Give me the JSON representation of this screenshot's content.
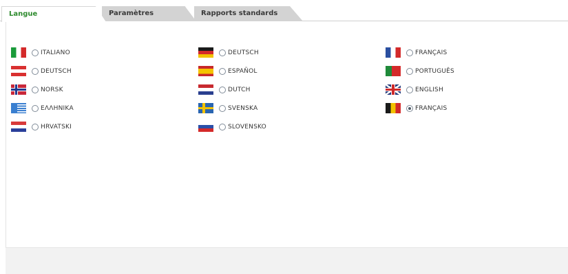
{
  "tabs": [
    {
      "label": "Langue",
      "active": true
    },
    {
      "label": "Paramètres",
      "active": false
    },
    {
      "label": "Rapports standards",
      "active": false
    }
  ],
  "languages": {
    "col1": [
      {
        "label": "ITALIANO",
        "flag": "italy-flag-icon",
        "checked": false
      },
      {
        "label": "DEUTSCH",
        "flag": "austria-flag-icon",
        "checked": false
      },
      {
        "label": "NORSK",
        "flag": "norway-flag-icon",
        "checked": false
      },
      {
        "label": "ΕΛΛΗΝΙΚΑ",
        "flag": "greece-flag-icon",
        "checked": false
      },
      {
        "label": "HRVATSKI",
        "flag": "croatia-flag-icon",
        "checked": false
      }
    ],
    "col2": [
      {
        "label": "DEUTSCH",
        "flag": "germany-flag-icon",
        "checked": false
      },
      {
        "label": "ESPAÑOL",
        "flag": "spain-flag-icon",
        "checked": false
      },
      {
        "label": "DUTCH",
        "flag": "netherlands-flag-icon",
        "checked": false
      },
      {
        "label": "SVENSKA",
        "flag": "sweden-flag-icon",
        "checked": false
      },
      {
        "label": "SLOVENSKO",
        "flag": "slovenia-flag-icon",
        "checked": false
      }
    ],
    "col3": [
      {
        "label": "FRANÇAIS",
        "flag": "france-flag-icon",
        "checked": false
      },
      {
        "label": "PORTUGUÊS",
        "flag": "portugal-flag-icon",
        "checked": false
      },
      {
        "label": "ENGLISH",
        "flag": "uk-flag-icon",
        "checked": false
      },
      {
        "label": "FRANÇAIS",
        "flag": "belgium-flag-icon",
        "checked": true
      }
    ]
  }
}
